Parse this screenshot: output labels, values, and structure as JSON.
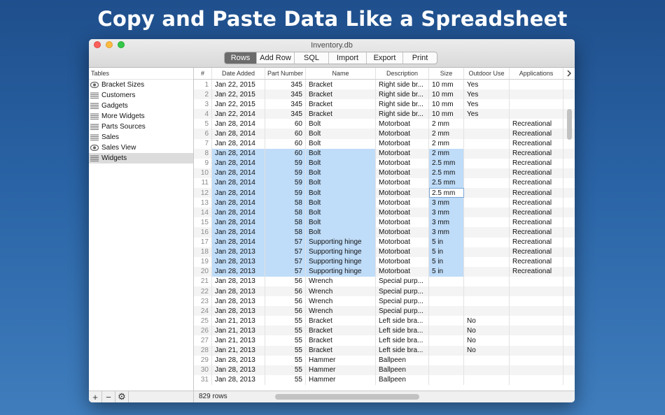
{
  "headline": "Copy and Paste Data Like a Spreadsheet",
  "window": {
    "title": "Inventory.db"
  },
  "toolbar": [
    {
      "label": "Rows",
      "width": 46,
      "active": true
    },
    {
      "label": "Add Row",
      "width": 54
    },
    {
      "label": "SQL",
      "width": 49
    },
    {
      "label": "Import",
      "width": 54
    },
    {
      "label": "Export",
      "width": 52
    },
    {
      "label": "Print",
      "width": 48
    }
  ],
  "sidebar": {
    "header": "Tables",
    "items": [
      {
        "label": "Bracket Sizes",
        "icon": "eye-icon"
      },
      {
        "label": "Customers",
        "icon": "table-icon"
      },
      {
        "label": "Gadgets",
        "icon": "table-icon"
      },
      {
        "label": "More Widgets",
        "icon": "table-icon"
      },
      {
        "label": "Parts Sources",
        "icon": "table-icon"
      },
      {
        "label": "Sales",
        "icon": "table-icon"
      },
      {
        "label": "Sales View",
        "icon": "eye-icon"
      },
      {
        "label": "Widgets",
        "icon": "table-icon",
        "selected": true
      }
    ],
    "footer": [
      "+",
      "−",
      "⚙"
    ]
  },
  "table": {
    "columns": [
      "#",
      "Date Added",
      "Part Number",
      "Name",
      "Description",
      "Size",
      "Outdoor Use",
      "Applications"
    ],
    "rows": [
      [
        "1",
        "Jan 22, 2015",
        "345",
        "Bracket",
        "Right side br...",
        "10 mm",
        "Yes",
        ""
      ],
      [
        "2",
        "Jan 22, 2015",
        "345",
        "Bracket",
        "Right side br...",
        "10 mm",
        "Yes",
        ""
      ],
      [
        "3",
        "Jan 22, 2015",
        "345",
        "Bracket",
        "Right side br...",
        "10 mm",
        "Yes",
        ""
      ],
      [
        "4",
        "Jan 22, 2014",
        "345",
        "Bracket",
        "Right side br...",
        "10 mm",
        "Yes",
        ""
      ],
      [
        "5",
        "Jan 28, 2014",
        "60",
        "Bolt",
        "Motorboat",
        "2 mm",
        "",
        "Recreational"
      ],
      [
        "6",
        "Jan 28, 2014",
        "60",
        "Bolt",
        "Motorboat",
        "2 mm",
        "",
        "Recreational"
      ],
      [
        "7",
        "Jan 28, 2014",
        "60",
        "Bolt",
        "Motorboat",
        "2 mm",
        "",
        "Recreational"
      ],
      [
        "8",
        "Jan 28, 2014",
        "60",
        "Bolt",
        "Motorboat",
        "2 mm",
        "",
        "Recreational"
      ],
      [
        "9",
        "Jan 28, 2014",
        "59",
        "Bolt",
        "Motorboat",
        "2.5 mm",
        "",
        "Recreational"
      ],
      [
        "10",
        "Jan 28, 2014",
        "59",
        "Bolt",
        "Motorboat",
        "2.5 mm",
        "",
        "Recreational"
      ],
      [
        "11",
        "Jan 28, 2014",
        "59",
        "Bolt",
        "Motorboat",
        "2.5 mm",
        "",
        "Recreational"
      ],
      [
        "12",
        "Jan 28, 2014",
        "59",
        "Bolt",
        "Motorboat",
        "2.5 mm",
        "",
        "Recreational"
      ],
      [
        "13",
        "Jan 28, 2014",
        "58",
        "Bolt",
        "Motorboat",
        "3 mm",
        "",
        "Recreational"
      ],
      [
        "14",
        "Jan 28, 2014",
        "58",
        "Bolt",
        "Motorboat",
        "3 mm",
        "",
        "Recreational"
      ],
      [
        "15",
        "Jan 28, 2014",
        "58",
        "Bolt",
        "Motorboat",
        "3 mm",
        "",
        "Recreational"
      ],
      [
        "16",
        "Jan 28, 2014",
        "58",
        "Bolt",
        "Motorboat",
        "3 mm",
        "",
        "Recreational"
      ],
      [
        "17",
        "Jan 28, 2014",
        "57",
        "Supporting hinge",
        "Motorboat",
        "5 in",
        "",
        "Recreational"
      ],
      [
        "18",
        "Jan 28, 2013",
        "57",
        "Supporting hinge",
        "Motorboat",
        "5 in",
        "",
        "Recreational"
      ],
      [
        "19",
        "Jan 28, 2013",
        "57",
        "Supporting hinge",
        "Motorboat",
        "5 in",
        "",
        "Recreational"
      ],
      [
        "20",
        "Jan 28, 2013",
        "57",
        "Supporting hinge",
        "Motorboat",
        "5 in",
        "",
        "Recreational"
      ],
      [
        "21",
        "Jan 28, 2013",
        "56",
        "Wrench",
        "Special purp...",
        "",
        "",
        ""
      ],
      [
        "22",
        "Jan 28, 2013",
        "56",
        "Wrench",
        "Special purp...",
        "",
        "",
        ""
      ],
      [
        "23",
        "Jan 28, 2013",
        "56",
        "Wrench",
        "Special purp...",
        "",
        "",
        ""
      ],
      [
        "24",
        "Jan 28, 2013",
        "56",
        "Wrench",
        "Special purp...",
        "",
        "",
        ""
      ],
      [
        "25",
        "Jan 21, 2013",
        "55",
        "Bracket",
        "Left side bra...",
        "",
        "No",
        ""
      ],
      [
        "26",
        "Jan 21, 2013",
        "55",
        "Bracket",
        "Left side bra...",
        "",
        "No",
        ""
      ],
      [
        "27",
        "Jan 21, 2013",
        "55",
        "Bracket",
        "Left side bra...",
        "",
        "No",
        ""
      ],
      [
        "28",
        "Jan 21, 2013",
        "55",
        "Bracket",
        "Left side bra...",
        "",
        "No",
        ""
      ],
      [
        "29",
        "Jan 28, 2013",
        "55",
        "Hammer",
        "Ballpeen",
        "",
        "",
        ""
      ],
      [
        "30",
        "Jan 28, 2013",
        "55",
        "Hammer",
        "Ballpeen",
        "",
        "",
        ""
      ],
      [
        "31",
        "Jan 28, 2013",
        "55",
        "Hammer",
        "Ballpeen",
        "",
        "",
        ""
      ]
    ],
    "selection": {
      "first_row": 8,
      "last_row": 20,
      "first_col": 1,
      "last_col": 3,
      "size_first_row": 8,
      "size_last_row": 20,
      "editing_row": 12
    }
  },
  "status": {
    "rows_label": "829 rows"
  }
}
